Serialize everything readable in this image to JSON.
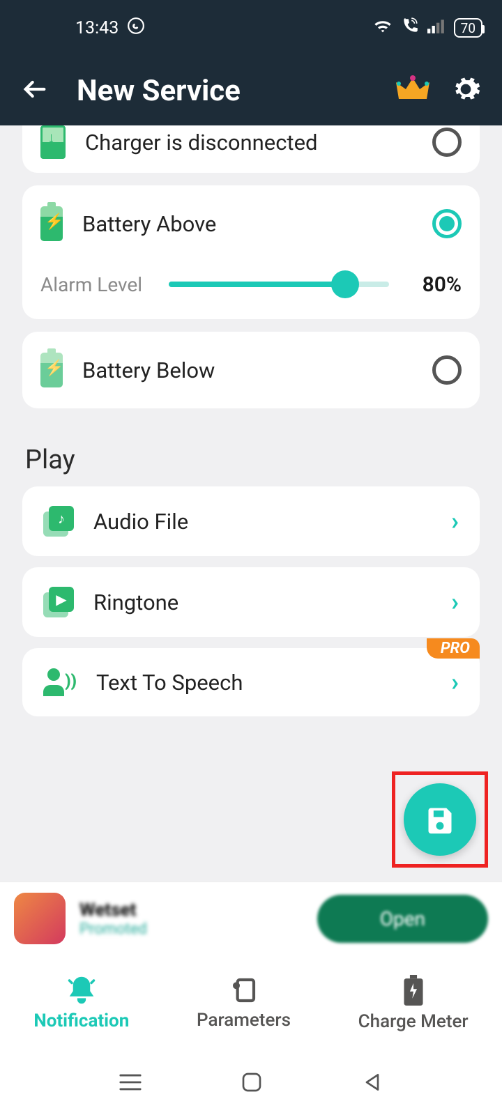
{
  "statusbar": {
    "time": "13:43",
    "battery_pct": "70"
  },
  "appbar": {
    "title": "New Service"
  },
  "options": {
    "charger_disconnected": {
      "label": "Charger is disconnected",
      "selected": false
    },
    "battery_above": {
      "label": "Battery Above",
      "selected": true
    },
    "battery_below": {
      "label": "Battery Below",
      "selected": false
    },
    "alarm": {
      "label": "Alarm Level",
      "value_pct": 80,
      "value_text": "80%"
    }
  },
  "play": {
    "section": "Play",
    "audio_file": "Audio File",
    "ringtone": "Ringtone",
    "tts": "Text To Speech",
    "pro_badge": "PRO"
  },
  "ad": {
    "title": "Wetset",
    "subtitle": "Promoted",
    "cta": "Open"
  },
  "nav": {
    "notification": "Notification",
    "parameters": "Parameters",
    "charge_meter": "Charge Meter"
  }
}
